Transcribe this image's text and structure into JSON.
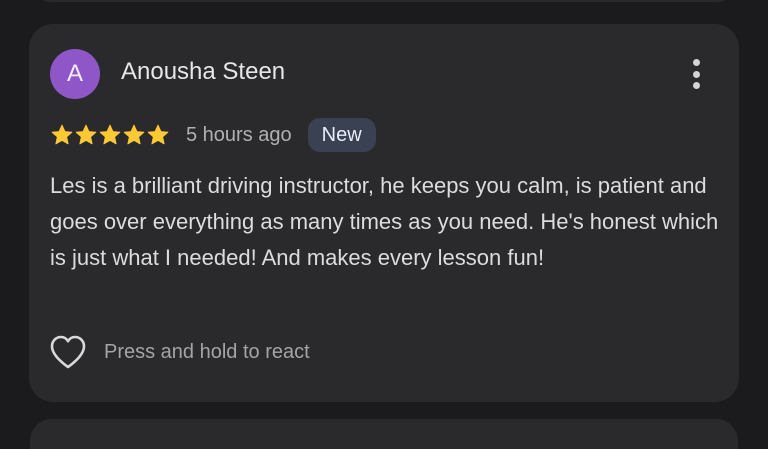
{
  "review": {
    "avatar_initial": "A",
    "reviewer_name": "Anousha Steen",
    "rating": 5,
    "rating_max": 5,
    "time_ago": "5 hours ago",
    "badge": "New",
    "text": "Les is a brilliant driving instructor, he keeps you calm, is patient and goes over everything as many times as you need. He's honest which is just what I needed! And makes every lesson fun!",
    "react_hint": "Press and hold to react"
  },
  "icons": {
    "more": "more-vertical-icon",
    "star": "star-icon",
    "heart": "heart-outline-icon"
  },
  "colors": {
    "background": "#1b1b1d",
    "card": "#2a2a2d",
    "avatar": "#8e56c6",
    "star": "#fcc934",
    "badge_bg": "#3a4153",
    "text_primary": "#e6e6e8",
    "text_secondary": "#a4a4a8"
  }
}
